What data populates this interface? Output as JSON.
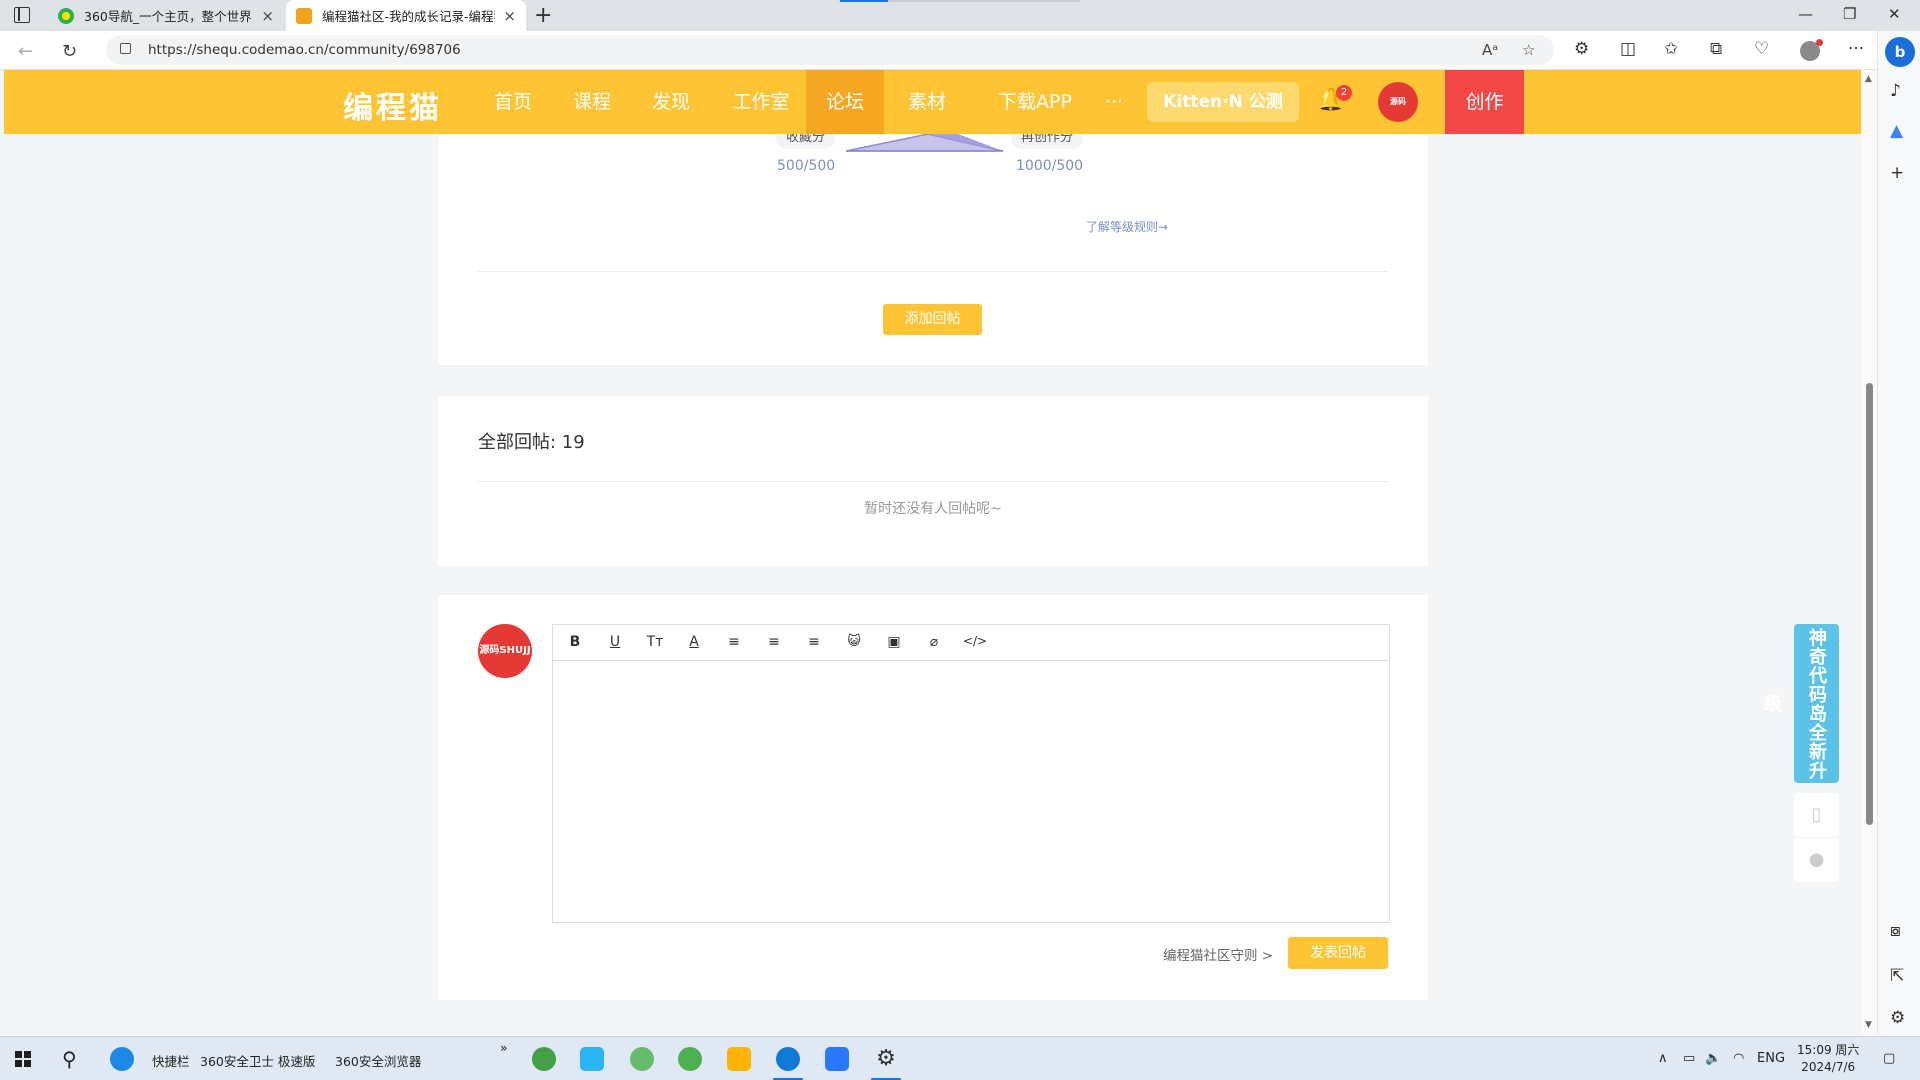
{
  "browser": {
    "tabs": [
      {
        "title": "360导航_一个主页，整个世界",
        "close": "×"
      },
      {
        "title": "编程猫社区-我的成长记录-编程猫",
        "close": "×"
      }
    ],
    "new_tab": "+",
    "url": "https://shequ.codemao.cn/community/698706",
    "window_controls": {
      "minimize": "—",
      "restore": "❐",
      "close": "✕"
    }
  },
  "site": {
    "logo": "编程猫",
    "nav": [
      "首页",
      "课程",
      "发现",
      "工作室",
      "论坛",
      "素材",
      "下载APP",
      "···"
    ],
    "active_nav": "论坛",
    "kitten_label": "Kitten·N 公测",
    "notification_count": "2",
    "avatar_text": "源码SHUJJ",
    "create_label": "创作"
  },
  "post_card": {
    "metrics": [
      {
        "label": "收藏分",
        "value": "500/500"
      },
      {
        "label": "再创作分",
        "value": "1000/500"
      }
    ],
    "rule_link": "了解等级规则→",
    "add_reply_button": "添加回帖"
  },
  "replies": {
    "title": "全部回帖: 19",
    "empty_tip": "暂时还没有人回帖呢~"
  },
  "composer": {
    "toolbar": [
      {
        "name": "bold-icon",
        "glyph": "B"
      },
      {
        "name": "underline-icon",
        "glyph": "U"
      },
      {
        "name": "font-size-icon",
        "glyph": "Tт"
      },
      {
        "name": "font-color-icon",
        "glyph": "A"
      },
      {
        "name": "align-left-icon",
        "glyph": "≡"
      },
      {
        "name": "align-center-icon",
        "glyph": "≡"
      },
      {
        "name": "align-right-icon",
        "glyph": "≡"
      },
      {
        "name": "emoji-icon",
        "glyph": "😺"
      },
      {
        "name": "image-icon",
        "glyph": "▣"
      },
      {
        "name": "attachment-icon",
        "glyph": "⌀"
      },
      {
        "name": "code-icon",
        "glyph": "</>"
      }
    ],
    "guide_link": "编程猫社区守则 >",
    "submit_button": "发表回帖"
  },
  "float_ad": "神奇代码岛全新升级",
  "taskbar": {
    "quick_bar": "快捷栏",
    "apps": [
      "360安全卫士 极速版",
      "360安全浏览器"
    ],
    "more": "»",
    "lang": "ENG",
    "time": "15:09 周六",
    "date": "2024/7/6"
  },
  "colors": {
    "brand_yellow": "#fec433",
    "nav_active": "#f5a623",
    "create_red": "#f24848",
    "link_blue": "#7a8fc5"
  }
}
